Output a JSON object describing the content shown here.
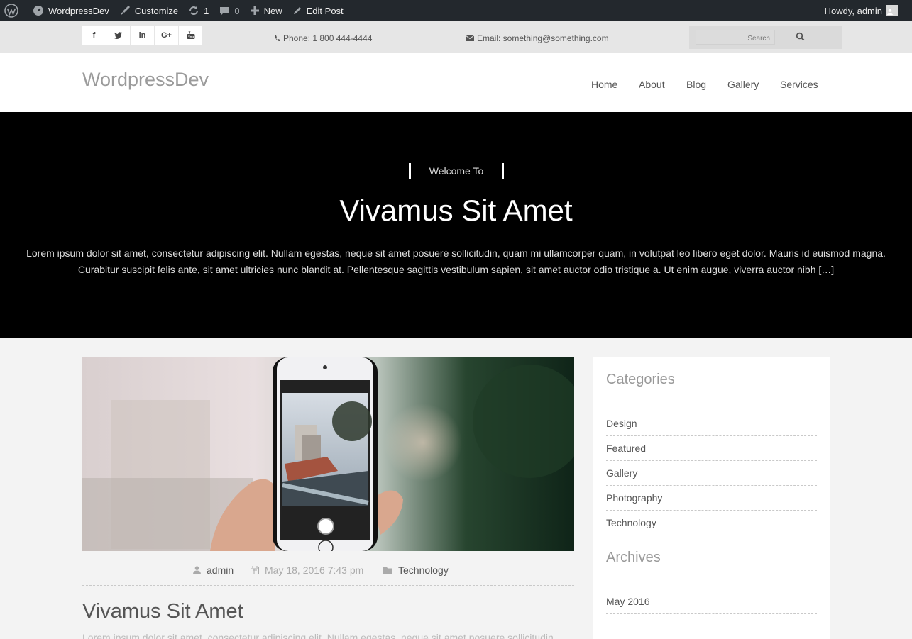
{
  "admin_bar": {
    "site_name": "WordpressDev",
    "customize": "Customize",
    "updates_count": "1",
    "comments_count": "0",
    "new_label": "New",
    "edit_post": "Edit Post",
    "greeting": "Howdy, admin"
  },
  "topbar": {
    "socials": [
      "f",
      "t",
      "in",
      "G+",
      "yt"
    ],
    "phone": "Phone: 1 800 444-4444",
    "email": "Email: something@something.com",
    "search_placeholder": "Search"
  },
  "header": {
    "site_title": "WordpressDev",
    "nav": [
      "Home",
      "About",
      "Blog",
      "Gallery",
      "Services"
    ]
  },
  "hero": {
    "welcome": "Welcome To",
    "title": "Vivamus Sit Amet",
    "text": "Lorem ipsum dolor sit amet, consectetur adipiscing elit. Nullam egestas, neque sit amet posuere sollicitudin, quam mi ullamcorper quam, in volutpat leo libero eget dolor. Mauris id euismod magna. Curabitur suscipit felis ante, sit amet ultricies nunc blandit at. Pellentesque sagittis vestibulum sapien, sit amet auctor odio tristique a. Ut enim augue, viverra auctor nibh […]"
  },
  "post": {
    "author": "admin",
    "date": "May 18, 2016 7:43 pm",
    "category": "Technology",
    "title": "Vivamus Sit Amet",
    "excerpt": "Lorem ipsum dolor sit amet, consectetur adipiscing elit. Nullam egestas, neque sit amet posuere sollicitudin,"
  },
  "sidebar": {
    "categories_title": "Categories",
    "categories": [
      "Design",
      "Featured",
      "Gallery",
      "Photography",
      "Technology"
    ],
    "archives_title": "Archives",
    "archives": [
      "May 2016"
    ]
  }
}
